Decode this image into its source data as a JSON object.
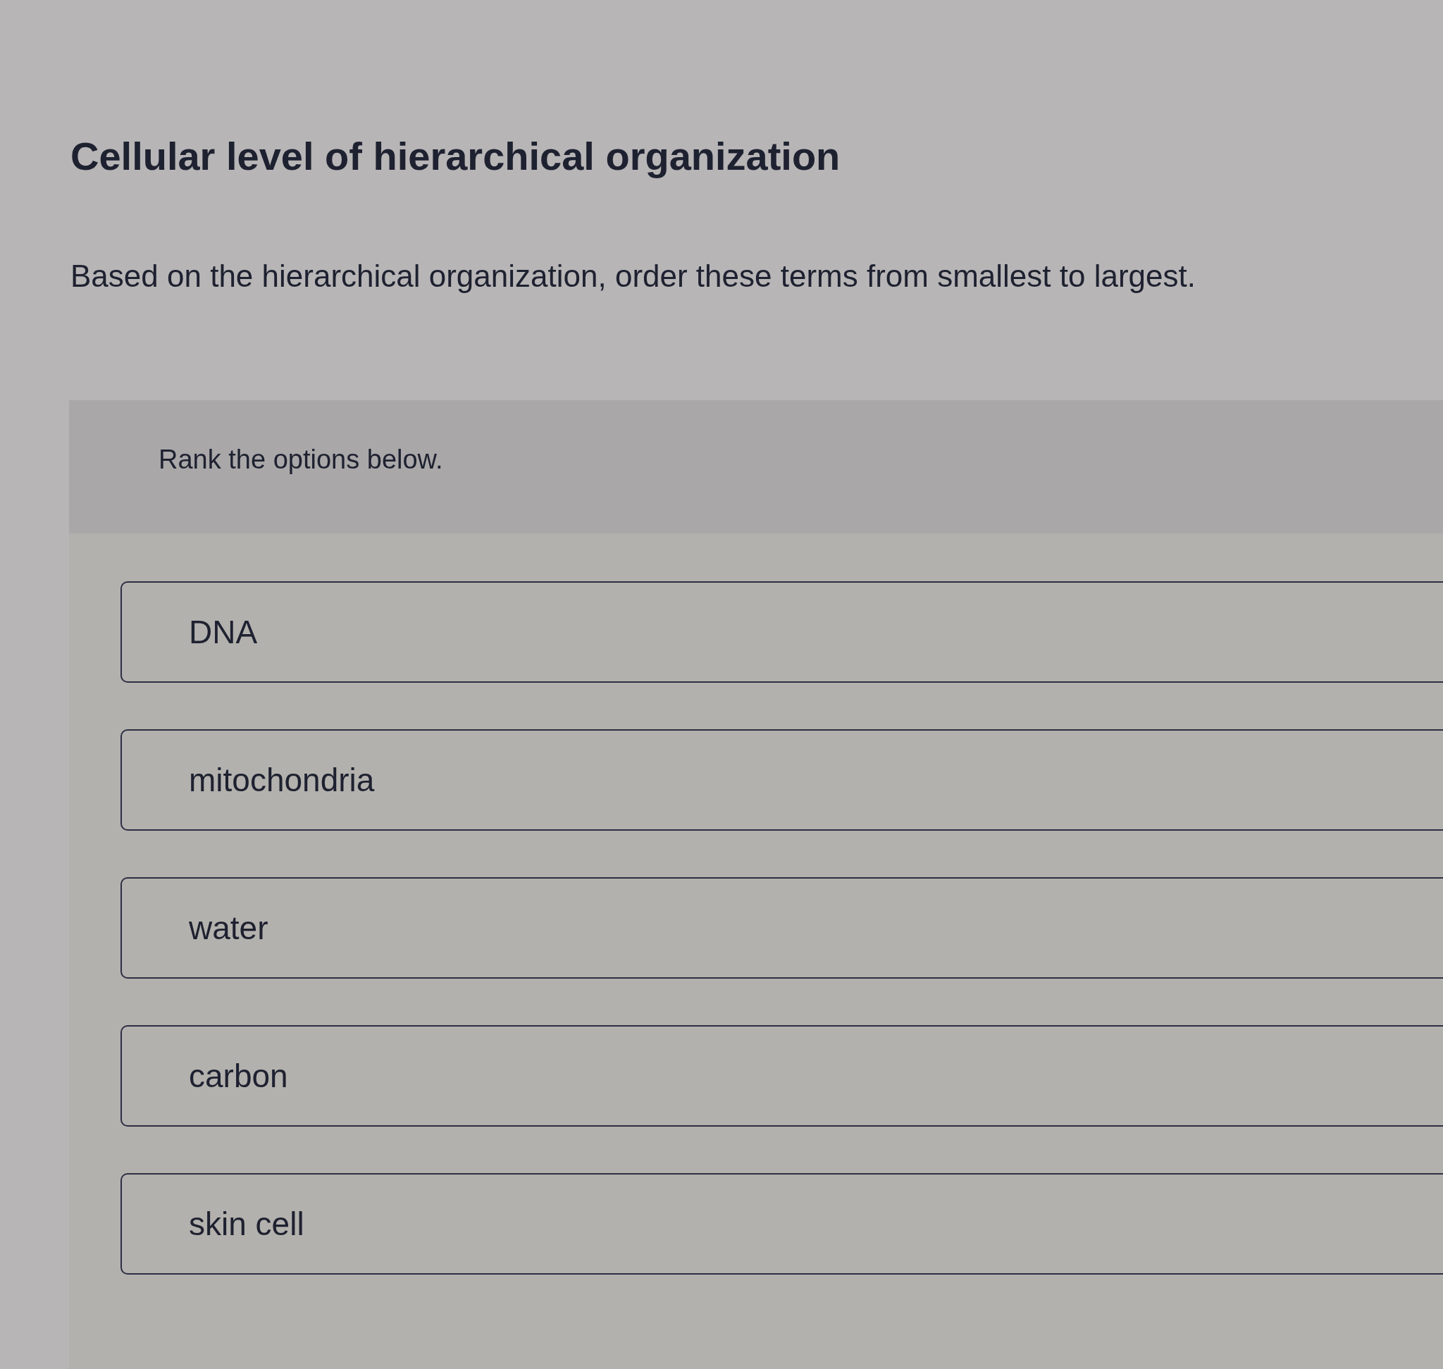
{
  "title": "Cellular level of hierarchical organization",
  "question": "Based on the hierarchical organization, order these terms from smallest to largest.",
  "ranking": {
    "instruction": "Rank the options below.",
    "options": [
      "DNA",
      "mitochondria",
      "water",
      "carbon",
      "skin cell"
    ]
  }
}
